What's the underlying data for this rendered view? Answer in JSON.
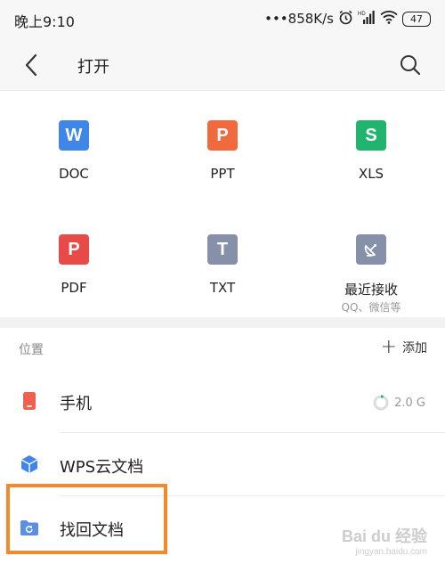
{
  "status_bar": {
    "time": "晚上9:10",
    "speed": "•••858K/s",
    "battery": "47"
  },
  "header": {
    "title": "打开"
  },
  "file_types": [
    {
      "label": "DOC",
      "letter": "W",
      "color": "#3f86e8"
    },
    {
      "label": "PPT",
      "letter": "P",
      "color": "#f06a3d"
    },
    {
      "label": "XLS",
      "letter": "S",
      "color": "#20b46e"
    },
    {
      "label": "PDF",
      "letter": "P",
      "color": "#e84b47"
    },
    {
      "label": "TXT",
      "letter": "T",
      "color": "#8690a8"
    },
    {
      "label": "最近接收",
      "sublabel": "QQ、微信等",
      "icon": "satellite-dish-icon",
      "color": "#8690a8"
    }
  ],
  "locations": {
    "section_title": "位置",
    "add_label": "添加",
    "items": [
      {
        "label": "手机",
        "icon": "phone-icon",
        "storage": "2.0 G",
        "color": "#f0604f"
      },
      {
        "label": "WPS云文档",
        "icon": "cloud-cube-icon",
        "color": "#3f86e8"
      },
      {
        "label": "找回文档",
        "icon": "recover-folder-icon",
        "color": "#5b8fe6"
      }
    ]
  },
  "watermark": {
    "text": "Bai du 经验",
    "sub": "jingyan.baidu.com"
  }
}
